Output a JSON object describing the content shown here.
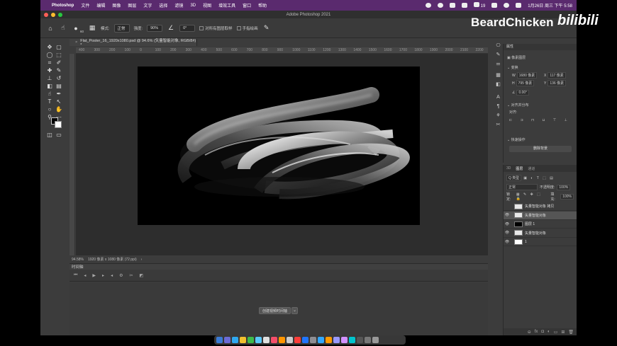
{
  "menubar": {
    "app_name": "Photoshop",
    "menus": [
      "文件",
      "编辑",
      "图像",
      "图层",
      "文字",
      "选择",
      "滤镜",
      "3D",
      "视图",
      "增效工具",
      "窗口",
      "帮助"
    ],
    "datetime": "1月26日 周三 下午 5:58",
    "battery": "19"
  },
  "window": {
    "title": "Adobe Photoshop 2021"
  },
  "options_bar": {
    "brush_size": "60",
    "mode_label": "模式:",
    "mode_value": "正常",
    "opacity_label": "强度:",
    "opacity_value": "90%",
    "angle_value": "0°",
    "sample_all_layers": "对所有图层取样",
    "finger_paint": "手指绘画"
  },
  "document": {
    "tab_title": "Flat_Poster_16_1920x1080.psd @ 94.6% (矢量智能对象, RGB/8#) *",
    "zoom": "94.58%",
    "size_info": "1920 像素 x 1080 像素 (72 ppi)",
    "ruler_ticks": [
      "400",
      "300",
      "200",
      "100",
      "0",
      "100",
      "200",
      "300",
      "400",
      "500",
      "600",
      "700",
      "800",
      "900",
      "1000",
      "1100",
      "1200",
      "1300",
      "1400",
      "1500",
      "1600",
      "1700",
      "1800",
      "1900",
      "2000",
      "2100",
      "2200"
    ]
  },
  "timeline": {
    "title": "时间轴",
    "create_button": "创建视频时间轴"
  },
  "properties": {
    "title": "属性",
    "smart_object_label": "像素图层",
    "transform_label": "变换",
    "w_label": "W",
    "w_value": "1680 像素",
    "x_label": "X",
    "x_value": "117 像素",
    "h_label": "H",
    "h_value": "795 像素",
    "y_label": "Y",
    "y_value": "136 像素",
    "angle_value": "0.00°",
    "align_label": "对齐并分布",
    "align_sub": "对齐:",
    "quick_actions_label": "快速操作",
    "remove_bg_button": "删除背景"
  },
  "layers": {
    "tabs": [
      "3D",
      "图层",
      "通道"
    ],
    "active_tab": "图层",
    "kind_filter": "Q 类型",
    "blend_mode": "正常",
    "opacity_label": "不透明度:",
    "opacity_value": "100%",
    "lock_label": "锁定:",
    "fill_label": "填充:",
    "fill_value": "100%",
    "items": [
      {
        "name": "矢量智能对象 拷贝",
        "visible": false,
        "thumb": "#e8e8e8",
        "selected": false
      },
      {
        "name": "矢量智能对象",
        "visible": true,
        "thumb": "#e8e8e8",
        "selected": true
      },
      {
        "name": "图层 1",
        "visible": true,
        "thumb": "#000000",
        "selected": false
      },
      {
        "name": "矢量智能对象",
        "visible": true,
        "thumb": "#e8e8e8",
        "selected": false
      },
      {
        "name": "1",
        "visible": true,
        "thumb": "#ffffff",
        "selected": false
      }
    ]
  },
  "watermark": {
    "brand": "BeardChicken",
    "logo_text": "bilibili"
  },
  "colors": {
    "menubar_bg": "#5a2a6e",
    "panel_bg": "#3c3c3c",
    "canvas_bg": "#2d2d2d",
    "artboard_bg": "#000000",
    "swatch_fg": "#000000",
    "swatch_bg": "#ffffff"
  }
}
